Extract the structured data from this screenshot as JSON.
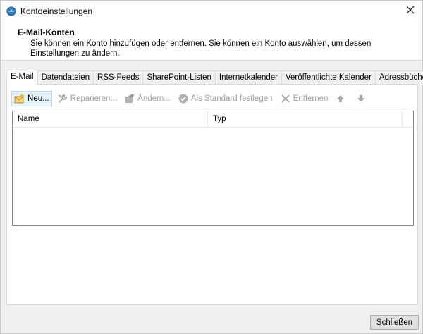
{
  "window": {
    "title": "Kontoeinstellungen"
  },
  "header": {
    "title": "E-Mail-Konten",
    "description": "Sie können ein Konto hinzufügen oder entfernen. Sie können ein Konto auswählen, um dessen Einstellungen zu ändern."
  },
  "tabs": [
    {
      "label": "E-Mail",
      "active": true
    },
    {
      "label": "Datendateien"
    },
    {
      "label": "RSS-Feeds"
    },
    {
      "label": "SharePoint-Listen"
    },
    {
      "label": "Internetkalender"
    },
    {
      "label": "Veröffentlichte Kalender"
    },
    {
      "label": "Adressbücher"
    }
  ],
  "toolbar": {
    "new": "Neu...",
    "repair": "Reparieren...",
    "change": "Ändern...",
    "set_default": "Als Standard festlegen",
    "remove": "Entfernen"
  },
  "list": {
    "columns": [
      "Name",
      "Typ"
    ],
    "rows": []
  },
  "footer": {
    "close_label": "Schließen"
  },
  "colors": {
    "accent": "#0078d7",
    "disabled": "#a0a0a0"
  }
}
